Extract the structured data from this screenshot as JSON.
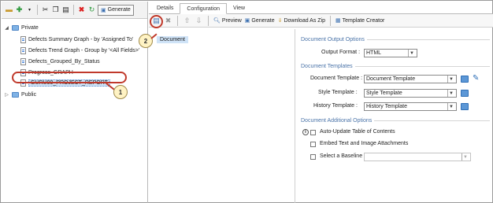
{
  "left_toolbar": {
    "generate_label": "Generate"
  },
  "tree": {
    "private_label": "Private",
    "items": [
      "Defects Summary Graph - by 'Assigned To'",
      "Defects Trend Graph - Group by '<All Fields>'",
      "Defects_Grouped_By_Status",
      "Progress_GRAPH",
      "GURU99_PROJECT_REPORT"
    ],
    "public_label": "Public"
  },
  "callouts": {
    "one": "1",
    "two": "2"
  },
  "tabs": [
    {
      "label": "Details"
    },
    {
      "label": "Configuration"
    },
    {
      "label": "View"
    }
  ],
  "right_toolbar": {
    "preview": "Preview",
    "generate": "Generate",
    "download_zip": "Download As Zip",
    "template_creator": "Template Creator"
  },
  "document_list": {
    "selected": "Document"
  },
  "options": {
    "output_header": "Document Output Options",
    "output_format_label": "Output Format :",
    "output_format_value": "HTML",
    "templates_header": "Document Templates",
    "document_template_label": "Document Template :",
    "document_template_value": "Document Template",
    "style_template_label": "Style Template :",
    "style_template_value": "Style Template",
    "history_template_label": "History Template :",
    "history_template_value": "History Template",
    "additional_header": "Document Additional Options",
    "auto_update_toc": "Auto-Update Table of Contents",
    "embed_text": "Embed Text and Image Attachments",
    "select_baseline": "Select a Baseline :"
  },
  "colors": {
    "accent": "#4a73a8",
    "callout_red": "#c0392b",
    "selection": "#cfe3f7"
  }
}
